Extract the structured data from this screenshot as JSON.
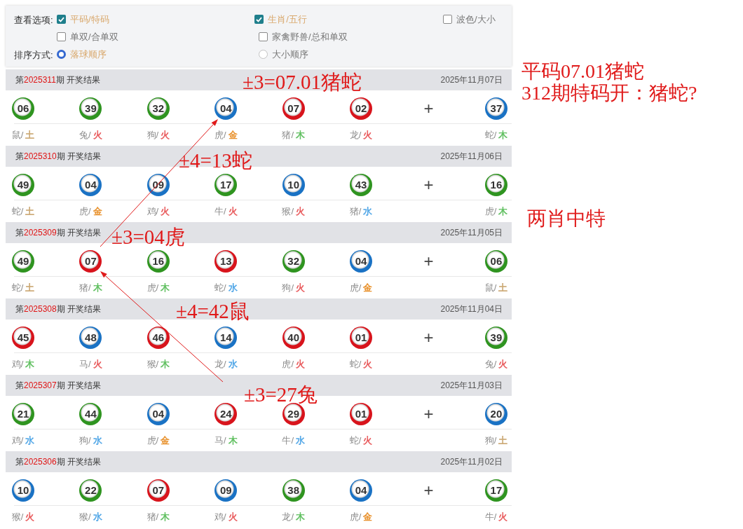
{
  "view_options": {
    "label": "查看选项:",
    "rows": [
      [
        {
          "label": "平码/特码",
          "checked": true
        },
        {
          "label": "生肖/五行",
          "checked": true
        },
        {
          "label": "波色/大小",
          "checked": false
        }
      ],
      [
        {
          "label": "单双/合单双",
          "checked": false
        },
        {
          "label": "家禽野兽/总和单双",
          "checked": false
        }
      ]
    ]
  },
  "sort": {
    "label": "排序方式:",
    "options": [
      {
        "label": "落球顺序",
        "selected": true
      },
      {
        "label": "大小顺序",
        "selected": false
      }
    ]
  },
  "draws": [
    {
      "title_prefix": "第",
      "period": "2025311",
      "title_suffix": "期 开奖结果",
      "date": "2025年11月07日",
      "separator": "+",
      "balls": [
        {
          "number": "06",
          "color": "#2f9420",
          "zodiac": "鼠/",
          "element": {
            "text": "土",
            "color": "#c8a36c"
          }
        },
        {
          "number": "39",
          "color": "#2f9420",
          "zodiac": "兔/",
          "element": {
            "text": "火",
            "color": "#e8585a"
          }
        },
        {
          "number": "32",
          "color": "#2f9420",
          "zodiac": "狗/",
          "element": {
            "text": "火",
            "color": "#e8585a"
          }
        },
        {
          "number": "04",
          "color": "#1a72c4",
          "zodiac": "虎/",
          "element": {
            "text": "金",
            "color": "#e8902a"
          }
        },
        {
          "number": "07",
          "color": "#d8141c",
          "zodiac": "猪/",
          "element": {
            "text": "木",
            "color": "#5fbf5f"
          }
        },
        {
          "number": "02",
          "color": "#d8141c",
          "zodiac": "龙/",
          "element": {
            "text": "火",
            "color": "#e8585a"
          }
        }
      ],
      "special": {
        "number": "37",
        "color": "#1a72c4",
        "zodiac": "蛇/",
        "element": {
          "text": "木",
          "color": "#5fbf5f"
        }
      }
    },
    {
      "title_prefix": "第",
      "period": "2025310",
      "title_suffix": "期 开奖结果",
      "date": "2025年11月06日",
      "separator": "+",
      "balls": [
        {
          "number": "49",
          "color": "#2f9420",
          "zodiac": "蛇/",
          "element": {
            "text": "土",
            "color": "#c8a36c"
          }
        },
        {
          "number": "04",
          "color": "#1a72c4",
          "zodiac": "虎/",
          "element": {
            "text": "金",
            "color": "#e8902a"
          }
        },
        {
          "number": "09",
          "color": "#1a72c4",
          "zodiac": "鸡/",
          "element": {
            "text": "火",
            "color": "#e8585a"
          }
        },
        {
          "number": "17",
          "color": "#2f9420",
          "zodiac": "牛/",
          "element": {
            "text": "火",
            "color": "#e8585a"
          }
        },
        {
          "number": "10",
          "color": "#1a72c4",
          "zodiac": "猴/",
          "element": {
            "text": "火",
            "color": "#e8585a"
          }
        },
        {
          "number": "43",
          "color": "#2f9420",
          "zodiac": "猪/",
          "element": {
            "text": "水",
            "color": "#4aa3e6"
          }
        }
      ],
      "special": {
        "number": "16",
        "color": "#2f9420",
        "zodiac": "虎/",
        "element": {
          "text": "木",
          "color": "#5fbf5f"
        }
      }
    },
    {
      "title_prefix": "第",
      "period": "2025309",
      "title_suffix": "期 开奖结果",
      "date": "2025年11月05日",
      "separator": "+",
      "balls": [
        {
          "number": "49",
          "color": "#2f9420",
          "zodiac": "蛇/",
          "element": {
            "text": "土",
            "color": "#c8a36c"
          }
        },
        {
          "number": "07",
          "color": "#d8141c",
          "zodiac": "猪/",
          "element": {
            "text": "木",
            "color": "#5fbf5f"
          }
        },
        {
          "number": "16",
          "color": "#2f9420",
          "zodiac": "虎/",
          "element": {
            "text": "木",
            "color": "#5fbf5f"
          }
        },
        {
          "number": "13",
          "color": "#d8141c",
          "zodiac": "蛇/",
          "element": {
            "text": "水",
            "color": "#4aa3e6"
          }
        },
        {
          "number": "32",
          "color": "#2f9420",
          "zodiac": "狗/",
          "element": {
            "text": "火",
            "color": "#e8585a"
          }
        },
        {
          "number": "04",
          "color": "#1a72c4",
          "zodiac": "虎/",
          "element": {
            "text": "金",
            "color": "#e8902a"
          }
        }
      ],
      "special": {
        "number": "06",
        "color": "#2f9420",
        "zodiac": "鼠/",
        "element": {
          "text": "土",
          "color": "#c8a36c"
        }
      }
    },
    {
      "title_prefix": "第",
      "period": "2025308",
      "title_suffix": "期 开奖结果",
      "date": "2025年11月04日",
      "separator": "+",
      "balls": [
        {
          "number": "45",
          "color": "#d8141c",
          "zodiac": "鸡/",
          "element": {
            "text": "木",
            "color": "#5fbf5f"
          }
        },
        {
          "number": "48",
          "color": "#1a72c4",
          "zodiac": "马/",
          "element": {
            "text": "火",
            "color": "#e8585a"
          }
        },
        {
          "number": "46",
          "color": "#d8141c",
          "zodiac": "猴/",
          "element": {
            "text": "木",
            "color": "#5fbf5f"
          }
        },
        {
          "number": "14",
          "color": "#1a72c4",
          "zodiac": "龙/",
          "element": {
            "text": "水",
            "color": "#4aa3e6"
          }
        },
        {
          "number": "40",
          "color": "#d8141c",
          "zodiac": "虎/",
          "element": {
            "text": "火",
            "color": "#e8585a"
          }
        },
        {
          "number": "01",
          "color": "#d8141c",
          "zodiac": "蛇/",
          "element": {
            "text": "火",
            "color": "#e8585a"
          }
        }
      ],
      "special": {
        "number": "39",
        "color": "#2f9420",
        "zodiac": "兔/",
        "element": {
          "text": "火",
          "color": "#e8585a"
        }
      }
    },
    {
      "title_prefix": "第",
      "period": "2025307",
      "title_suffix": "期 开奖结果",
      "date": "2025年11月03日",
      "separator": "+",
      "balls": [
        {
          "number": "21",
          "color": "#2f9420",
          "zodiac": "鸡/",
          "element": {
            "text": "水",
            "color": "#4aa3e6"
          }
        },
        {
          "number": "44",
          "color": "#2f9420",
          "zodiac": "狗/",
          "element": {
            "text": "水",
            "color": "#4aa3e6"
          }
        },
        {
          "number": "04",
          "color": "#1a72c4",
          "zodiac": "虎/",
          "element": {
            "text": "金",
            "color": "#e8902a"
          }
        },
        {
          "number": "24",
          "color": "#d8141c",
          "zodiac": "马/",
          "element": {
            "text": "木",
            "color": "#5fbf5f"
          }
        },
        {
          "number": "29",
          "color": "#d8141c",
          "zodiac": "牛/",
          "element": {
            "text": "水",
            "color": "#4aa3e6"
          }
        },
        {
          "number": "01",
          "color": "#d8141c",
          "zodiac": "蛇/",
          "element": {
            "text": "火",
            "color": "#e8585a"
          }
        }
      ],
      "special": {
        "number": "20",
        "color": "#1a72c4",
        "zodiac": "狗/",
        "element": {
          "text": "土",
          "color": "#c8a36c"
        }
      }
    },
    {
      "title_prefix": "第",
      "period": "2025306",
      "title_suffix": "期 开奖结果",
      "date": "2025年11月02日",
      "separator": "+",
      "balls": [
        {
          "number": "10",
          "color": "#1a72c4",
          "zodiac": "猴/",
          "element": {
            "text": "火",
            "color": "#e8585a"
          }
        },
        {
          "number": "22",
          "color": "#2f9420",
          "zodiac": "猴/",
          "element": {
            "text": "水",
            "color": "#4aa3e6"
          }
        },
        {
          "number": "07",
          "color": "#d8141c",
          "zodiac": "猪/",
          "element": {
            "text": "木",
            "color": "#5fbf5f"
          }
        },
        {
          "number": "09",
          "color": "#1a72c4",
          "zodiac": "鸡/",
          "element": {
            "text": "火",
            "color": "#e8585a"
          }
        },
        {
          "number": "38",
          "color": "#2f9420",
          "zodiac": "龙/",
          "element": {
            "text": "木",
            "color": "#5fbf5f"
          }
        },
        {
          "number": "04",
          "color": "#1a72c4",
          "zodiac": "虎/",
          "element": {
            "text": "金",
            "color": "#e8902a"
          }
        }
      ],
      "special": {
        "number": "17",
        "color": "#2f9420",
        "zodiac": "牛/",
        "element": {
          "text": "火",
          "color": "#e8585a"
        }
      }
    }
  ],
  "annotations": [
    {
      "text": "±3=07.01猪蛇"
    },
    {
      "text": "±4=13蛇"
    },
    {
      "text": "±3=04虎"
    },
    {
      "text": "±4=42鼠"
    },
    {
      "text": "±3=27兔"
    }
  ],
  "notes": [
    {
      "text": "平码07.01猪蛇"
    },
    {
      "text": "312期特码开：猪蛇?"
    },
    {
      "text": "两肖中特"
    }
  ]
}
